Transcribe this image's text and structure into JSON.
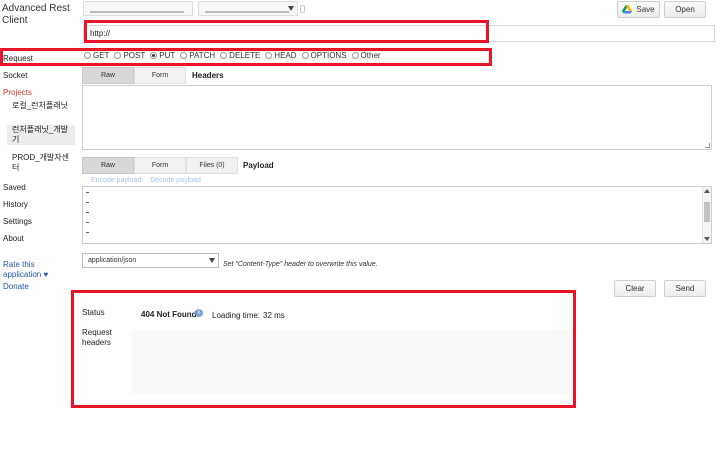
{
  "sidebar": {
    "app_title": "Advanced Rest Client",
    "items": {
      "request": "Request",
      "socket": "Socket",
      "projects": "Projects",
      "saved": "Saved",
      "history": "History",
      "settings": "Settings",
      "about": "About"
    },
    "projects": [
      "로컬_런처플래닛",
      "런처플래닛_개발기",
      "PROD_개발자센터"
    ],
    "rate_link": "Rate this application ♥",
    "donate": "Donate"
  },
  "toolbar": {
    "save_label": "Save",
    "open_label": "Open"
  },
  "url": {
    "value": "http://"
  },
  "methods": {
    "options": [
      "GET",
      "POST",
      "PUT",
      "PATCH",
      "DELETE",
      "HEAD",
      "OPTIONS",
      "Other"
    ],
    "selected": "PUT"
  },
  "headers_section": {
    "tabs": [
      "Raw",
      "Form"
    ],
    "heading": "Headers"
  },
  "payload_section": {
    "tabs": [
      "Raw",
      "Form",
      "Files (0)"
    ],
    "heading": "Payload",
    "encode_link": "Encode payload",
    "decode_link": "Decode payload"
  },
  "content_type": {
    "selected": "application/json",
    "hint": "Set \"Content-Type\" header to overwrite this value."
  },
  "actions": {
    "clear_label": "Clear",
    "send_label": "Send"
  },
  "response": {
    "status_label": "Status",
    "status_value": "404 Not Found",
    "loading_label": "Loading time:",
    "loading_value": "32 ms",
    "request_headers_label": "Request headers"
  },
  "colors": {
    "annotation_red": "#e8142a",
    "link_blue": "#2a54a8",
    "projects_red": "#d43a2a"
  }
}
